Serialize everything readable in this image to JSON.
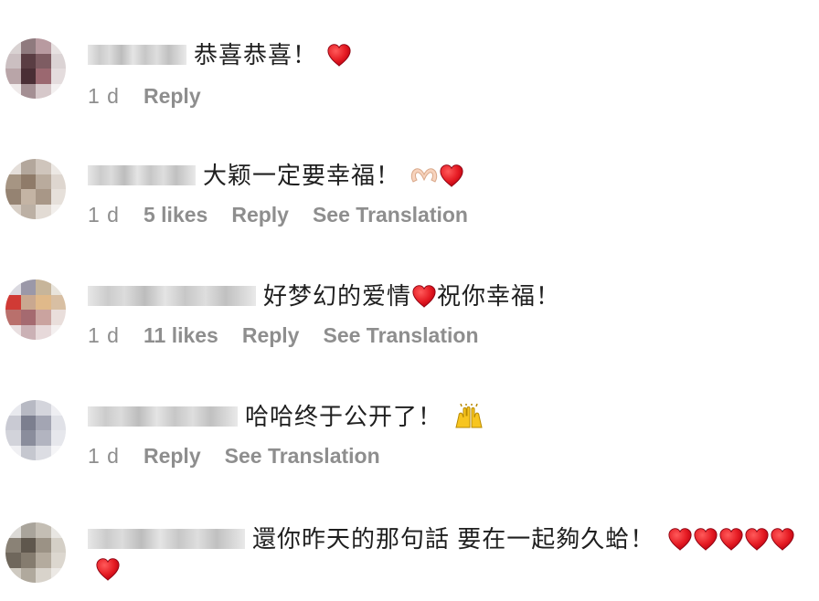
{
  "comments": [
    {
      "text": "恭喜恭喜！",
      "emojis": [
        "heart-icon"
      ],
      "time": "1 d",
      "likes": "",
      "reply": "Reply",
      "translate": ""
    },
    {
      "text": "大颖一定要幸福！",
      "emojis": [
        "heart-hands-icon",
        "heart-icon"
      ],
      "time": "1 d",
      "likes": "5 likes",
      "reply": "Reply",
      "translate": "See Translation"
    },
    {
      "text_before": "好梦幻的爱情",
      "text_after": "祝你幸福！",
      "emojis": [
        "heart-icon"
      ],
      "time": "1 d",
      "likes": "11 likes",
      "reply": "Reply",
      "translate": "See Translation"
    },
    {
      "text": "哈哈终于公开了！",
      "emojis": [
        "raising-hands-icon"
      ],
      "time": "1 d",
      "likes": "",
      "reply": "Reply",
      "translate": "See Translation"
    },
    {
      "text": "還你昨天的那句話 要在一起夠久蛤！",
      "emojis": [
        "heart-icon",
        "heart-icon",
        "heart-icon",
        "heart-icon",
        "heart-icon",
        "heart-icon"
      ],
      "time": "",
      "likes": "",
      "reply": "",
      "translate": ""
    }
  ],
  "colors": {
    "meta_text": "#8e8e8e",
    "body_text": "#262626",
    "heart": "#e0142b"
  }
}
